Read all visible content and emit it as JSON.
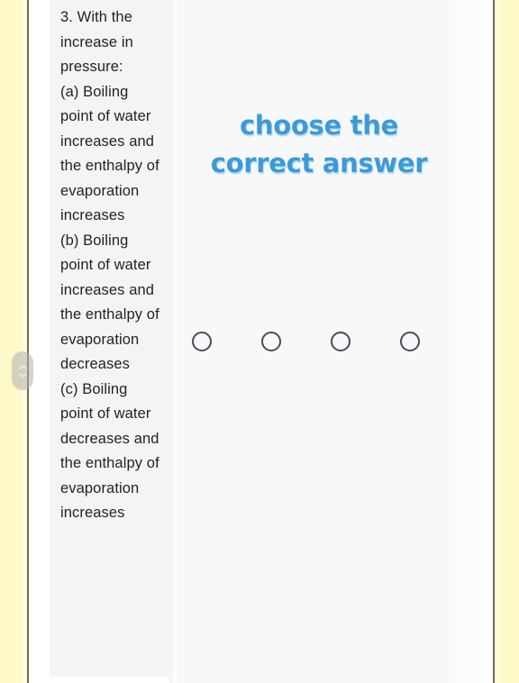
{
  "page": {
    "background_color": "#ffffff",
    "margin_color": "#fdf9c8",
    "rule_color": "#6f5a3b"
  },
  "scrollbar": {
    "name": "vertical-scroll-handle",
    "up_icon": "chevron-up-icon",
    "down_icon": "chevron-down-icon"
  },
  "question_panel": {
    "background_color": "#f3f4f6",
    "text": "3. With the increase in pressure:\n(a) Boiling point of water increases and the enthalpy of evaporation increases\n(b) Boiling point of water increases and the enthalpy of evaporation decreases\n(c) Boiling point of water decreases and the enthalpy of evaporation increases",
    "number": "3.",
    "stem": "With the increase in pressure:",
    "choices": [
      {
        "key": "(a)",
        "text": "Boiling point of water increases and the enthalpy of evaporation increases"
      },
      {
        "key": "(b)",
        "text": "Boiling point of water increases and the enthalpy of evaporation decreases"
      },
      {
        "key": "(c)",
        "text": "Boiling point of water decreases and the enthalpy of evaporation increases"
      }
    ]
  },
  "answer_panel": {
    "background_color": "#f6f8fa",
    "prompt_line_1": "choose the",
    "prompt_line_2": "correct answer",
    "prompt_color": "#3c9ad6",
    "options": [
      {
        "name": "option-circle-1",
        "selected": false
      },
      {
        "name": "option-circle-2",
        "selected": false
      },
      {
        "name": "option-circle-3",
        "selected": false
      },
      {
        "name": "option-circle-4",
        "selected": false
      }
    ]
  }
}
